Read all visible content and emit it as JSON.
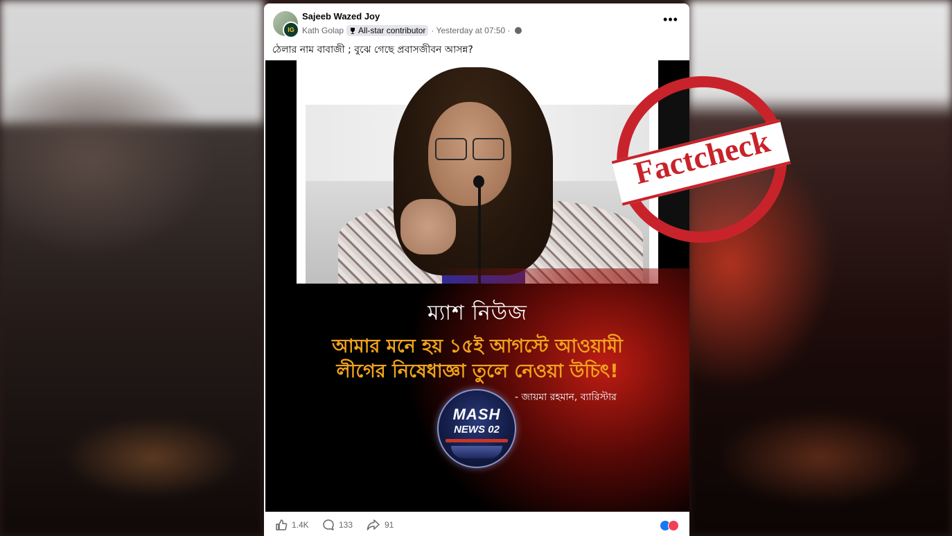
{
  "post": {
    "author_name": "Sajeeb Wazed Joy",
    "sub_author": "Kath Golap",
    "badge": "All-star contributor",
    "timestamp": "· Yesterday at 07:50 ·",
    "more_label": "•••",
    "text": "ঠেলার নাম বাবাজী ; বুঝে গেছে প্রবাসজীবন আসন্ন?",
    "avatar_badge": "IG"
  },
  "image": {
    "brand": "ম্যাশ নিউজ",
    "quote_line_1": "আমার মনে হয় ১৫ই আগস্টে আওয়ামী",
    "quote_line_2": "লীগের নিষেধাজ্ঞা তুলে নেওয়া উচিৎ!",
    "attribution": "- জায়মা রহমান, ব্যারিস্টার",
    "logo_line_1": "MASH",
    "logo_line_2": "NEWS 02"
  },
  "footer": {
    "likes": "1.4K",
    "comments": "133",
    "shares": "91"
  },
  "stamp": {
    "text": "Factcheck",
    "color": "#c8232b"
  },
  "colors": {
    "quote": "#f0a21c",
    "fb_blue": "#1877f2"
  }
}
